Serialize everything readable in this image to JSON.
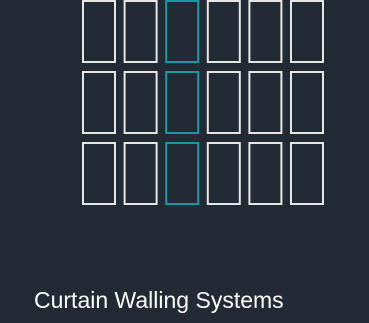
{
  "card": {
    "title": "Curtain Walling Systems"
  },
  "icon": {
    "name": "curtain-wall-icon",
    "rows": 3,
    "columns": 6,
    "highlighted_column": 3,
    "colors": {
      "background": "#222b35",
      "pane": "#e6e6e6",
      "highlight": "#159aa5",
      "text": "#ffffff"
    }
  }
}
